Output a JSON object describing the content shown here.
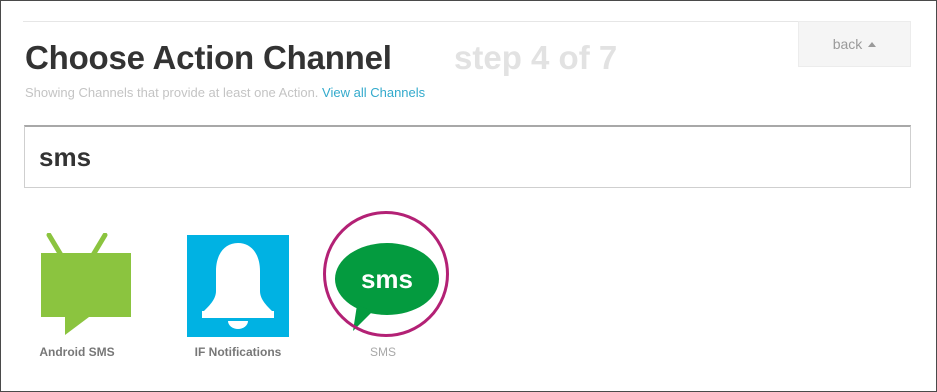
{
  "header": {
    "title": "Choose Action Channel",
    "step": "step 4 of 7",
    "subtitle_text": "Showing Channels that provide at least one Action.",
    "subtitle_link": "View all Channels",
    "back_label": "back"
  },
  "search": {
    "value": "sms"
  },
  "channels": [
    {
      "label": "Android SMS",
      "icon": "android-icon",
      "color": "#8bc43f"
    },
    {
      "label": "IF Notifications",
      "icon": "bell-icon",
      "color": "#00b2e3"
    },
    {
      "label": "SMS",
      "icon": "sms-bubble-icon",
      "color": "#049b3f",
      "icon_text": "sms"
    }
  ],
  "colors": {
    "highlight": "#b32175",
    "link": "#33aacc"
  }
}
